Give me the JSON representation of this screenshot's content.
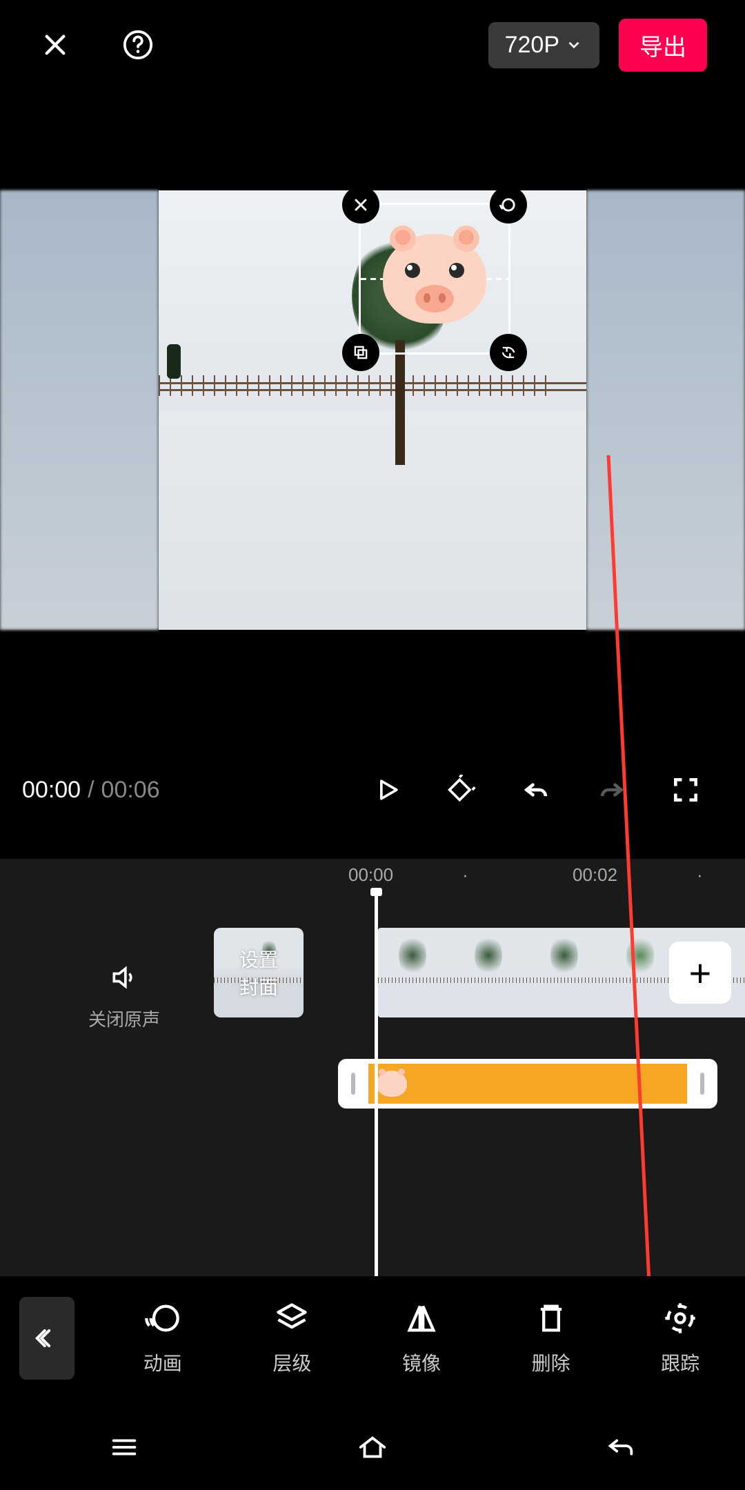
{
  "header": {
    "resolution_label": "720P",
    "export_label": "导出"
  },
  "playback": {
    "current_time": "00:00",
    "separator": "/",
    "total_time": "00:06"
  },
  "timeline": {
    "ruler_marks": {
      "m0": "00:00",
      "dot1": "·",
      "m2": "00:02",
      "dot2": "·"
    },
    "mute_label": "关闭原声",
    "cover_label_1": "设置",
    "cover_label_2": "封面",
    "add_label": "+"
  },
  "tools": {
    "animation": "动画",
    "layer": "层级",
    "mirror": "镜像",
    "delete": "删除",
    "track": "跟踪"
  }
}
